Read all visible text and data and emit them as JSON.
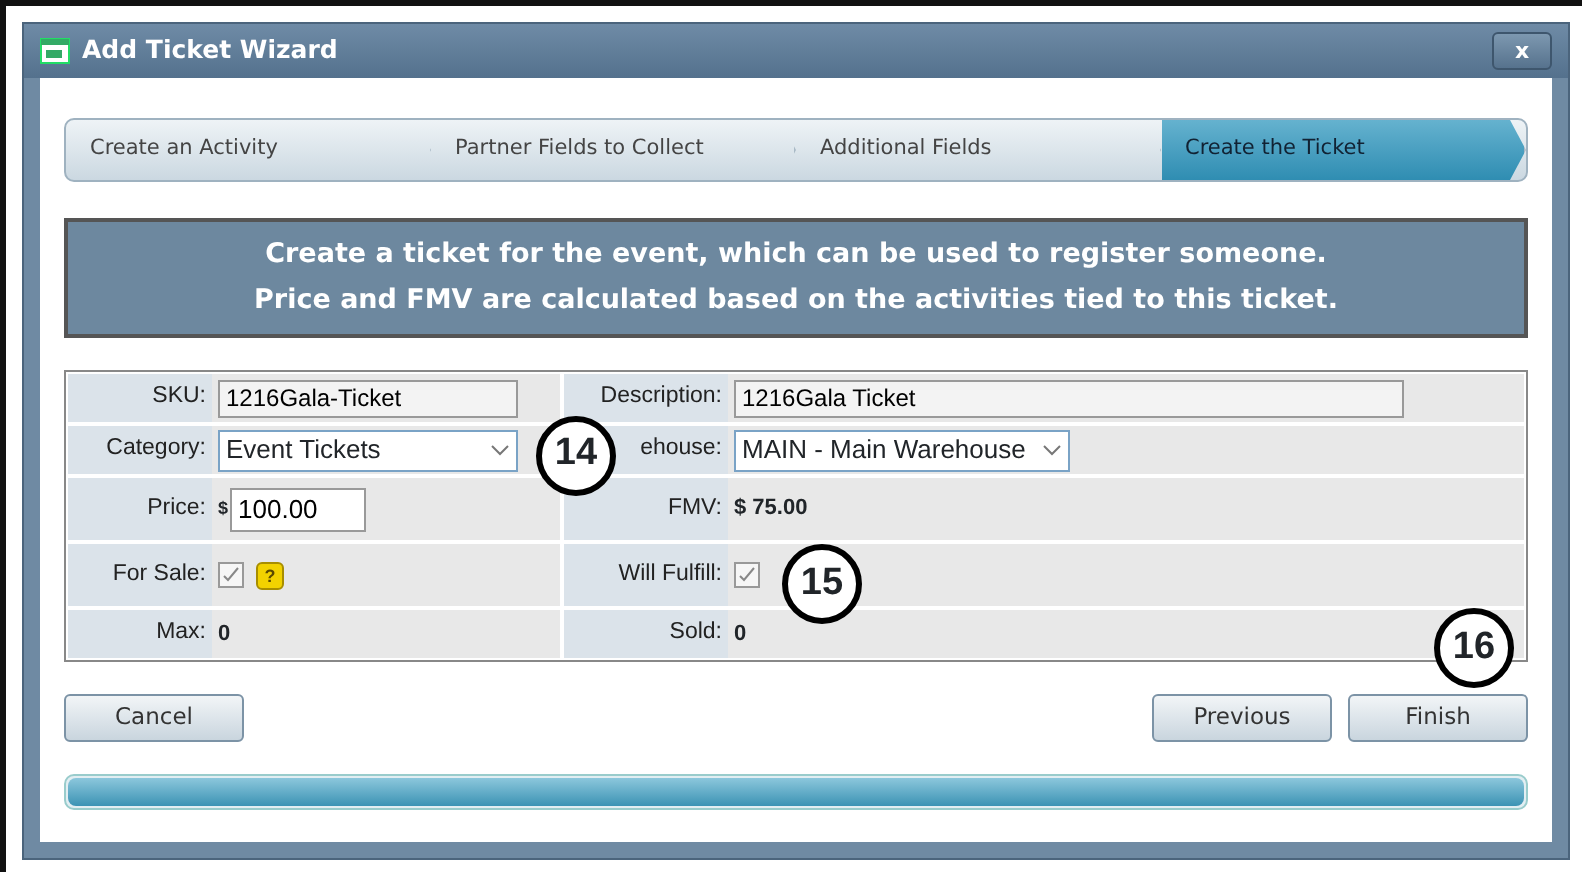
{
  "window": {
    "title": "Add Ticket Wizard",
    "close": "x"
  },
  "steps": [
    {
      "label": "Create an Activity",
      "selected": false
    },
    {
      "label": "Partner Fields to Collect",
      "selected": false
    },
    {
      "label": "Additional Fields",
      "selected": false
    },
    {
      "label": "Create the Ticket",
      "selected": true
    }
  ],
  "banner": [
    "Create a ticket for the event, which can be used to register someone.",
    "Price and FMV are calculated based on the activities tied to this ticket."
  ],
  "form_rows": [
    {
      "left": {
        "label": "SKU:",
        "kind": "text",
        "value": "1216Gala-Ticket"
      },
      "right": {
        "label": "Description:",
        "kind": "text",
        "value": "1216Gala Ticket"
      }
    },
    {
      "left": {
        "label": "Category:",
        "kind": "select",
        "value": "Event Tickets"
      },
      "right": {
        "label": "ehouse:",
        "kind": "select",
        "value": "MAIN - Main Warehouse"
      }
    },
    {
      "left": {
        "label": "Price:",
        "kind": "price",
        "prefix": "$",
        "value": "100.00"
      },
      "right": {
        "label": "FMV:",
        "kind": "static",
        "value": "$ 75.00"
      }
    },
    {
      "left": {
        "label": "For Sale:",
        "kind": "checkbox",
        "checked": true,
        "help": "?"
      },
      "right": {
        "label": "Will Fulfill:",
        "kind": "checkbox",
        "checked": true
      }
    },
    {
      "left": {
        "label": "Max:",
        "kind": "static",
        "value": "0"
      },
      "right": {
        "label": "Sold:",
        "kind": "static",
        "value": "0"
      }
    }
  ],
  "buttons": {
    "cancel": "Cancel",
    "previous": "Previous",
    "finish": "Finish"
  },
  "progress": {
    "level": 1
  },
  "callouts": [
    {
      "number": "14"
    },
    {
      "number": "15"
    },
    {
      "number": "16"
    }
  ]
}
